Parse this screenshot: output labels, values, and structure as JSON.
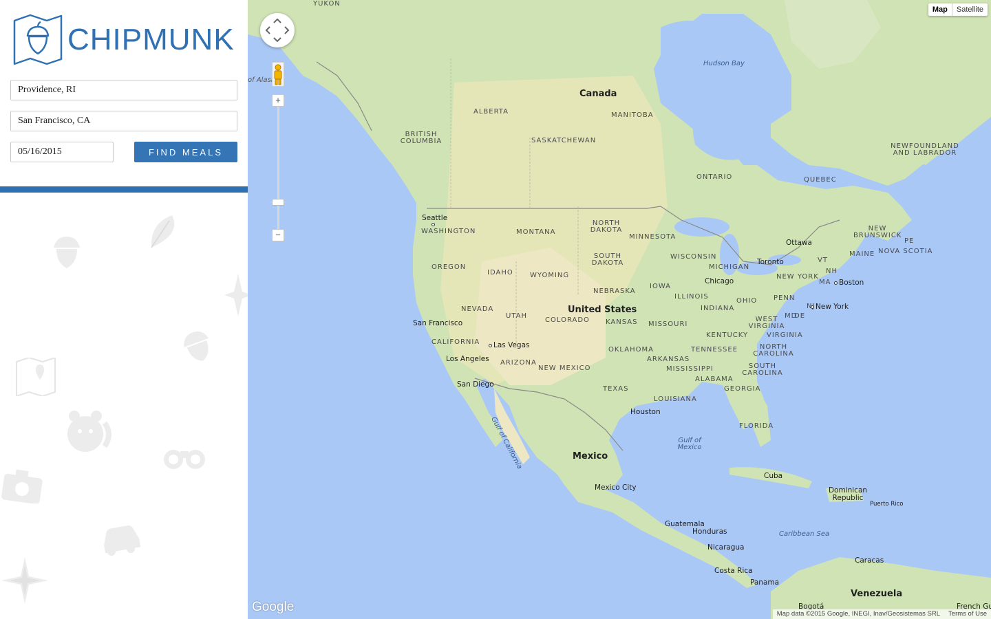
{
  "app": {
    "brand": "CHIPMUNK",
    "accent_color": "#3574b5"
  },
  "form": {
    "origin_value": "Providence, RI",
    "destination_value": "San Francisco, CA",
    "date_value": "05/16/2015",
    "submit_label": "FIND MEALS"
  },
  "map": {
    "type_controls": {
      "map_label": "Map",
      "satellite_label": "Satellite",
      "selected": "Map"
    },
    "labels": {
      "countries": [
        "Canada",
        "United States",
        "Mexico",
        "Cuba",
        "Dominican Republic",
        "Guatemala",
        "Honduras",
        "Nicaragua",
        "Costa Rica",
        "Panama",
        "Venezuela"
      ],
      "states": [
        "ALBERTA",
        "BRITISH COLUMBIA",
        "MANITOBA",
        "SASKATCHEWAN",
        "ONTARIO",
        "QUEBEC",
        "NEWFOUNDLAND AND LABRADOR",
        "WASHINGTON",
        "MONTANA",
        "NORTH DAKOTA",
        "MINNESOTA",
        "OREGON",
        "IDAHO",
        "WYOMING",
        "SOUTH DAKOTA",
        "WISCONSIN",
        "MICHIGAN",
        "NEBRASKA",
        "IOWA",
        "NEVADA",
        "UTAH",
        "COLORADO",
        "KANSAS",
        "MISSOURI",
        "ILLINOIS",
        "INDIANA",
        "OHIO",
        "PENN",
        "CALIFORNIA",
        "ARIZONA",
        "NEW MEXICO",
        "OKLAHOMA",
        "ARKANSAS",
        "TENNESSEE",
        "KENTUCKY",
        "WEST VIRGINIA",
        "VIRGINIA",
        "NORTH CAROLINA",
        "SOUTH CAROLINA",
        "MISSISSIPPI",
        "ALABAMA",
        "GEORGIA",
        "TEXAS",
        "LOUISIANA",
        "FLORIDA",
        "NEW YORK",
        "NEW BRUNSWICK",
        "NOVA SCOTIA",
        "MAINE",
        "VT",
        "NH",
        "MA",
        "MD",
        "DE",
        "NJ",
        "PE"
      ],
      "cities": [
        "Seattle",
        "San Francisco",
        "Las Vegas",
        "Los Angeles",
        "San Diego",
        "Chicago",
        "Toronto",
        "Ottawa",
        "Boston",
        "New York",
        "Houston",
        "Mexico City",
        "Puerto Rico",
        "Caracas"
      ],
      "water": [
        "Hudson Bay",
        "Gulf of Mexico",
        "Gulf of California",
        "Caribbean Sea"
      ],
      "partial": [
        "YUKON",
        "of Alask",
        "French Gu",
        "Bogotá"
      ]
    },
    "logo": "Google",
    "attribution": "Map data ©2015 Google, INEGI, Inav/Geosistemas SRL",
    "terms_label": "Terms of Use"
  }
}
